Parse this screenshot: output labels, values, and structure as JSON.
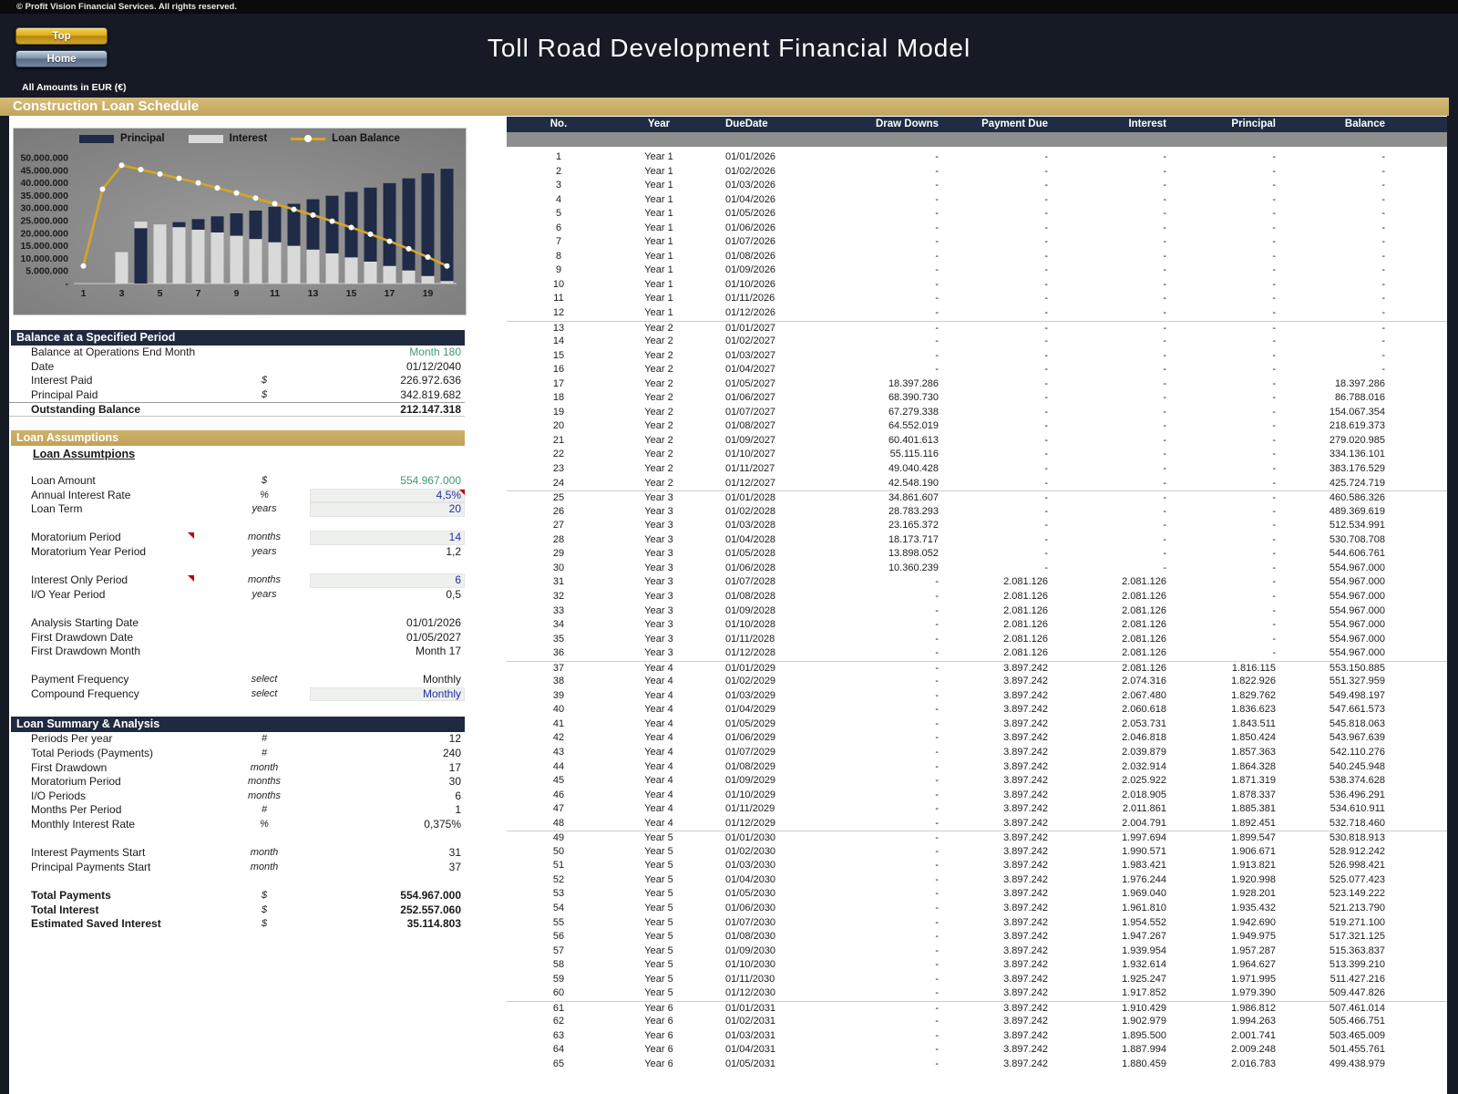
{
  "header": {
    "copyright": "© Profit Vision Financial Services. All rights reserved.",
    "title": "Toll Road Development Financial Model",
    "top_button": "Top",
    "home_button": "Home",
    "amounts_note": "All Amounts in  EUR (€)"
  },
  "gold_banner": "Construction Loan Schedule",
  "colors": {
    "gold_band": "#c9ad62",
    "navy_header": "#1f2a40",
    "principal": "#1f2b47",
    "interest": "#d9d9d9",
    "loan_balance_line": "#d9a521",
    "input_text": "#1f2da0",
    "green_text": "#3f9b6c",
    "grey_band": "#8e8e8e"
  },
  "chart_data": {
    "type": "bar",
    "title": "",
    "xlabel": "",
    "ylabel": "",
    "ylim_millions": [
      0,
      50
    ],
    "grid": false,
    "legend_position": "top",
    "categories": [
      1,
      2,
      3,
      4,
      5,
      6,
      7,
      8,
      9,
      10,
      11,
      12,
      13,
      14,
      15,
      16,
      17,
      18,
      19,
      20
    ],
    "x_tick_labels": [
      "1",
      "3",
      "5",
      "7",
      "9",
      "11",
      "13",
      "15",
      "17",
      "19"
    ],
    "y_ticks": [
      {
        "v": 50,
        "label": "50.000.000"
      },
      {
        "v": 45,
        "label": "45.000.000"
      },
      {
        "v": 40,
        "label": "40.000.000"
      },
      {
        "v": 35,
        "label": "35.000.000"
      },
      {
        "v": 30,
        "label": "30.000.000"
      },
      {
        "v": 25,
        "label": "25.000.000"
      },
      {
        "v": 20,
        "label": "20.000.000"
      },
      {
        "v": 15,
        "label": "15.000.000"
      },
      {
        "v": 10,
        "label": "10.000.000"
      },
      {
        "v": 5,
        "label": "5.000.000"
      },
      {
        "v": 0,
        "label": "-"
      }
    ],
    "series": [
      {
        "name": "Principal",
        "color_key": "principal",
        "kind": "bar"
      },
      {
        "name": "Interest",
        "color_key": "interest",
        "kind": "bar"
      },
      {
        "name": "Loan Balance",
        "color_key": "loan_balance_line",
        "kind": "line"
      }
    ],
    "bar_segments_millions": [
      [],
      [],
      [
        [
          "interest",
          12.5
        ]
      ],
      [
        [
          "principal",
          22.0
        ],
        [
          "interest",
          2.6
        ]
      ],
      [
        [
          "interest",
          23.5
        ]
      ],
      [
        [
          "interest",
          22.4
        ],
        [
          "principal",
          2.0
        ]
      ],
      [
        [
          "interest",
          21.4
        ],
        [
          "principal",
          4.2
        ]
      ],
      [
        [
          "interest",
          20.3
        ],
        [
          "principal",
          6.4
        ]
      ],
      [
        [
          "interest",
          19.0
        ],
        [
          "principal",
          8.9
        ]
      ],
      [
        [
          "interest",
          17.7
        ],
        [
          "principal",
          11.3
        ]
      ],
      [
        [
          "interest",
          16.4
        ],
        [
          "principal",
          14.1
        ]
      ],
      [
        [
          "interest",
          15.0
        ],
        [
          "principal",
          16.7
        ]
      ],
      [
        [
          "interest",
          13.5
        ],
        [
          "principal",
          20.0
        ]
      ],
      [
        [
          "interest",
          12.0
        ],
        [
          "principal",
          22.9
        ]
      ],
      [
        [
          "interest",
          10.4
        ],
        [
          "principal",
          26.0
        ]
      ],
      [
        [
          "interest",
          8.7
        ],
        [
          "principal",
          29.4
        ]
      ],
      [
        [
          "interest",
          7.0
        ],
        [
          "principal",
          32.9
        ]
      ],
      [
        [
          "interest",
          5.2
        ],
        [
          "principal",
          36.6
        ]
      ],
      [
        [
          "interest",
          3.0
        ],
        [
          "principal",
          40.8
        ]
      ],
      [
        [
          "interest",
          1.0
        ],
        [
          "principal",
          44.6
        ]
      ]
    ],
    "loan_balance_line_millions": [
      7.0,
      37.5,
      47.0,
      45.3,
      43.5,
      41.8,
      40.0,
      38.0,
      36.0,
      34.0,
      31.7,
      29.5,
      27.2,
      24.8,
      22.3,
      19.6,
      16.8,
      13.8,
      10.5,
      7.0
    ]
  },
  "balance_section": {
    "title": "Balance at a Specified Period",
    "rows": [
      {
        "label": "Balance at Operations End Month",
        "unit": "",
        "value": "Month 180",
        "color": "green"
      },
      {
        "label": "Date",
        "unit": "",
        "value": "01/12/2040"
      },
      {
        "label": "Interest Paid",
        "unit": "$",
        "value": "226.972.636"
      },
      {
        "label": "Principal Paid",
        "unit": "$",
        "value": "342.819.682"
      }
    ],
    "total_row": {
      "label": "Outstanding Balance",
      "unit": "",
      "value": "212.147.318"
    }
  },
  "assumptions_section": {
    "title": "Loan Assumptions",
    "subtitle": "Loan Assumtpions",
    "rows": [
      {
        "label": "Loan Amount",
        "unit": "$",
        "value": "554.967.000",
        "color": "green"
      },
      {
        "label": "Annual Interest Rate",
        "unit": "%",
        "value": "4,5%",
        "input": true,
        "color": "blue",
        "cell_marker": true
      },
      {
        "label": "Loan Term",
        "unit": "years",
        "value": "20",
        "input": true,
        "color": "blue"
      },
      {
        "gap": true
      },
      {
        "label": "Moratorium Period",
        "unit": "months",
        "value": "14",
        "input": true,
        "color": "blue",
        "label_marker": true
      },
      {
        "label": "Moratorium Year Period",
        "unit": "years",
        "value": "1,2"
      },
      {
        "gap": true
      },
      {
        "label": "Interest Only Period",
        "unit": "months",
        "value": "6",
        "input": true,
        "color": "blue",
        "label_marker": true
      },
      {
        "label": "I/O Year Period",
        "unit": "years",
        "value": "0,5"
      },
      {
        "gap": true
      },
      {
        "label": "Analysis Starting Date",
        "unit": "",
        "value": "01/01/2026"
      },
      {
        "label": "First Drawdown Date",
        "unit": "",
        "value": "01/05/2027"
      },
      {
        "label": "First Drawdown Month",
        "unit": "",
        "value": "Month 17"
      },
      {
        "gap": true
      },
      {
        "label": "Payment Frequency",
        "unit": "select",
        "value": "Monthly"
      },
      {
        "label": "Compound Frequency",
        "unit": "select",
        "value": "Monthly",
        "input": true,
        "color": "blue"
      }
    ]
  },
  "summary_section": {
    "title": "Loan Summary & Analysis",
    "rows": [
      {
        "label": "Periods Per year",
        "unit": "#",
        "value": "12"
      },
      {
        "label": "Total Periods (Payments)",
        "unit": "#",
        "value": "240"
      },
      {
        "label": "First Drawdown",
        "unit": "month",
        "value": "17"
      },
      {
        "label": "Moratorium Period",
        "unit": "months",
        "value": "30"
      },
      {
        "label": "I/O Periods",
        "unit": "months",
        "value": "6"
      },
      {
        "label": "Months Per Period",
        "unit": "#",
        "value": "1"
      },
      {
        "label": "Monthly Interest Rate",
        "unit": "%",
        "value": "0,375%"
      },
      {
        "gap": true
      },
      {
        "label": "Interest Payments Start",
        "unit": "month",
        "value": "31"
      },
      {
        "label": "Principal Payments Start",
        "unit": "month",
        "value": "37"
      },
      {
        "gap": true
      },
      {
        "label": "Total Payments",
        "unit": "$",
        "value": "554.967.000",
        "bold": true
      },
      {
        "label": "Total Interest",
        "unit": "$",
        "value": "252.557.060",
        "bold": true
      },
      {
        "label": "Estimated Saved Interest",
        "unit": "$",
        "value": "35.114.803",
        "bold": true
      }
    ]
  },
  "schedule_table": {
    "columns": [
      "No.",
      "Year",
      "DueDate",
      "Draw Downs",
      "Payment Due",
      "Interest",
      "Principal",
      "Balance"
    ],
    "rows": [
      [
        "1",
        "Year 1",
        "01/01/2026",
        "-",
        "-",
        "-",
        "-",
        "-"
      ],
      [
        "2",
        "Year 1",
        "01/02/2026",
        "-",
        "-",
        "-",
        "-",
        "-"
      ],
      [
        "3",
        "Year 1",
        "01/03/2026",
        "-",
        "-",
        "-",
        "-",
        "-"
      ],
      [
        "4",
        "Year 1",
        "01/04/2026",
        "-",
        "-",
        "-",
        "-",
        "-"
      ],
      [
        "5",
        "Year 1",
        "01/05/2026",
        "-",
        "-",
        "-",
        "-",
        "-"
      ],
      [
        "6",
        "Year 1",
        "01/06/2026",
        "-",
        "-",
        "-",
        "-",
        "-"
      ],
      [
        "7",
        "Year 1",
        "01/07/2026",
        "-",
        "-",
        "-",
        "-",
        "-"
      ],
      [
        "8",
        "Year 1",
        "01/08/2026",
        "-",
        "-",
        "-",
        "-",
        "-"
      ],
      [
        "9",
        "Year 1",
        "01/09/2026",
        "-",
        "-",
        "-",
        "-",
        "-"
      ],
      [
        "10",
        "Year 1",
        "01/10/2026",
        "-",
        "-",
        "-",
        "-",
        "-"
      ],
      [
        "11",
        "Year 1",
        "01/11/2026",
        "-",
        "-",
        "-",
        "-",
        "-"
      ],
      [
        "12",
        "Year 1",
        "01/12/2026",
        "-",
        "-",
        "-",
        "-",
        "-"
      ],
      [
        "13",
        "Year 2",
        "01/01/2027",
        "-",
        "-",
        "-",
        "-",
        "-"
      ],
      [
        "14",
        "Year 2",
        "01/02/2027",
        "-",
        "-",
        "-",
        "-",
        "-"
      ],
      [
        "15",
        "Year 2",
        "01/03/2027",
        "-",
        "-",
        "-",
        "-",
        "-"
      ],
      [
        "16",
        "Year 2",
        "01/04/2027",
        "-",
        "-",
        "-",
        "-",
        "-"
      ],
      [
        "17",
        "Year 2",
        "01/05/2027",
        "18.397.286",
        "-",
        "-",
        "-",
        "18.397.286"
      ],
      [
        "18",
        "Year 2",
        "01/06/2027",
        "68.390.730",
        "-",
        "-",
        "-",
        "86.788.016"
      ],
      [
        "19",
        "Year 2",
        "01/07/2027",
        "67.279.338",
        "-",
        "-",
        "-",
        "154.067.354"
      ],
      [
        "20",
        "Year 2",
        "01/08/2027",
        "64.552.019",
        "-",
        "-",
        "-",
        "218.619.373"
      ],
      [
        "21",
        "Year 2",
        "01/09/2027",
        "60.401.613",
        "-",
        "-",
        "-",
        "279.020.985"
      ],
      [
        "22",
        "Year 2",
        "01/10/2027",
        "55.115.116",
        "-",
        "-",
        "-",
        "334.136.101"
      ],
      [
        "23",
        "Year 2",
        "01/11/2027",
        "49.040.428",
        "-",
        "-",
        "-",
        "383.176.529"
      ],
      [
        "24",
        "Year 2",
        "01/12/2027",
        "42.548.190",
        "-",
        "-",
        "-",
        "425.724.719"
      ],
      [
        "25",
        "Year 3",
        "01/01/2028",
        "34.861.607",
        "-",
        "-",
        "-",
        "460.586.326"
      ],
      [
        "26",
        "Year 3",
        "01/02/2028",
        "28.783.293",
        "-",
        "-",
        "-",
        "489.369.619"
      ],
      [
        "27",
        "Year 3",
        "01/03/2028",
        "23.165.372",
        "-",
        "-",
        "-",
        "512.534.991"
      ],
      [
        "28",
        "Year 3",
        "01/04/2028",
        "18.173.717",
        "-",
        "-",
        "-",
        "530.708.708"
      ],
      [
        "29",
        "Year 3",
        "01/05/2028",
        "13.898.052",
        "-",
        "-",
        "-",
        "544.606.761"
      ],
      [
        "30",
        "Year 3",
        "01/06/2028",
        "10.360.239",
        "-",
        "-",
        "-",
        "554.967.000"
      ],
      [
        "31",
        "Year 3",
        "01/07/2028",
        "-",
        "2.081.126",
        "2.081.126",
        "-",
        "554.967.000"
      ],
      [
        "32",
        "Year 3",
        "01/08/2028",
        "-",
        "2.081.126",
        "2.081.126",
        "-",
        "554.967.000"
      ],
      [
        "33",
        "Year 3",
        "01/09/2028",
        "-",
        "2.081.126",
        "2.081.126",
        "-",
        "554.967.000"
      ],
      [
        "34",
        "Year 3",
        "01/10/2028",
        "-",
        "2.081.126",
        "2.081.126",
        "-",
        "554.967.000"
      ],
      [
        "35",
        "Year 3",
        "01/11/2028",
        "-",
        "2.081.126",
        "2.081.126",
        "-",
        "554.967.000"
      ],
      [
        "36",
        "Year 3",
        "01/12/2028",
        "-",
        "2.081.126",
        "2.081.126",
        "-",
        "554.967.000"
      ],
      [
        "37",
        "Year 4",
        "01/01/2029",
        "-",
        "3.897.242",
        "2.081.126",
        "1.816.115",
        "553.150.885"
      ],
      [
        "38",
        "Year 4",
        "01/02/2029",
        "-",
        "3.897.242",
        "2.074.316",
        "1.822.926",
        "551.327.959"
      ],
      [
        "39",
        "Year 4",
        "01/03/2029",
        "-",
        "3.897.242",
        "2.067.480",
        "1.829.762",
        "549.498.197"
      ],
      [
        "40",
        "Year 4",
        "01/04/2029",
        "-",
        "3.897.242",
        "2.060.618",
        "1.836.623",
        "547.661.573"
      ],
      [
        "41",
        "Year 4",
        "01/05/2029",
        "-",
        "3.897.242",
        "2.053.731",
        "1.843.511",
        "545.818.063"
      ],
      [
        "42",
        "Year 4",
        "01/06/2029",
        "-",
        "3.897.242",
        "2.046.818",
        "1.850.424",
        "543.967.639"
      ],
      [
        "43",
        "Year 4",
        "01/07/2029",
        "-",
        "3.897.242",
        "2.039.879",
        "1.857.363",
        "542.110.276"
      ],
      [
        "44",
        "Year 4",
        "01/08/2029",
        "-",
        "3.897.242",
        "2.032.914",
        "1.864.328",
        "540.245.948"
      ],
      [
        "45",
        "Year 4",
        "01/09/2029",
        "-",
        "3.897.242",
        "2.025.922",
        "1.871.319",
        "538.374.628"
      ],
      [
        "46",
        "Year 4",
        "01/10/2029",
        "-",
        "3.897.242",
        "2.018.905",
        "1.878.337",
        "536.496.291"
      ],
      [
        "47",
        "Year 4",
        "01/11/2029",
        "-",
        "3.897.242",
        "2.011.861",
        "1.885.381",
        "534.610.911"
      ],
      [
        "48",
        "Year 4",
        "01/12/2029",
        "-",
        "3.897.242",
        "2.004.791",
        "1.892.451",
        "532.718.460"
      ],
      [
        "49",
        "Year 5",
        "01/01/2030",
        "-",
        "3.897.242",
        "1.997.694",
        "1.899.547",
        "530.818.913"
      ],
      [
        "50",
        "Year 5",
        "01/02/2030",
        "-",
        "3.897.242",
        "1.990.571",
        "1.906.671",
        "528.912.242"
      ],
      [
        "51",
        "Year 5",
        "01/03/2030",
        "-",
        "3.897.242",
        "1.983.421",
        "1.913.821",
        "526.998.421"
      ],
      [
        "52",
        "Year 5",
        "01/04/2030",
        "-",
        "3.897.242",
        "1.976.244",
        "1.920.998",
        "525.077.423"
      ],
      [
        "53",
        "Year 5",
        "01/05/2030",
        "-",
        "3.897.242",
        "1.969.040",
        "1.928.201",
        "523.149.222"
      ],
      [
        "54",
        "Year 5",
        "01/06/2030",
        "-",
        "3.897.242",
        "1.961.810",
        "1.935.432",
        "521.213.790"
      ],
      [
        "55",
        "Year 5",
        "01/07/2030",
        "-",
        "3.897.242",
        "1.954.552",
        "1.942.690",
        "519.271.100"
      ],
      [
        "56",
        "Year 5",
        "01/08/2030",
        "-",
        "3.897.242",
        "1.947.267",
        "1.949.975",
        "517.321.125"
      ],
      [
        "57",
        "Year 5",
        "01/09/2030",
        "-",
        "3.897.242",
        "1.939.954",
        "1.957.287",
        "515.363.837"
      ],
      [
        "58",
        "Year 5",
        "01/10/2030",
        "-",
        "3.897.242",
        "1.932.614",
        "1.964.627",
        "513.399.210"
      ],
      [
        "59",
        "Year 5",
        "01/11/2030",
        "-",
        "3.897.242",
        "1.925.247",
        "1.971.995",
        "511.427.216"
      ],
      [
        "60",
        "Year 5",
        "01/12/2030",
        "-",
        "3.897.242",
        "1.917.852",
        "1.979.390",
        "509.447.826"
      ],
      [
        "61",
        "Year 6",
        "01/01/2031",
        "-",
        "3.897.242",
        "1.910.429",
        "1.986.812",
        "507.461.014"
      ],
      [
        "62",
        "Year 6",
        "01/02/2031",
        "-",
        "3.897.242",
        "1.902.979",
        "1.994.263",
        "505.466.751"
      ],
      [
        "63",
        "Year 6",
        "01/03/2031",
        "-",
        "3.897.242",
        "1.895.500",
        "2.001.741",
        "503.465.009"
      ],
      [
        "64",
        "Year 6",
        "01/04/2031",
        "-",
        "3.897.242",
        "1.887.994",
        "2.009.248",
        "501.455.761"
      ],
      [
        "65",
        "Year 6",
        "01/05/2031",
        "-",
        "3.897.242",
        "1.880.459",
        "2.016.783",
        "499.438.979"
      ]
    ]
  }
}
